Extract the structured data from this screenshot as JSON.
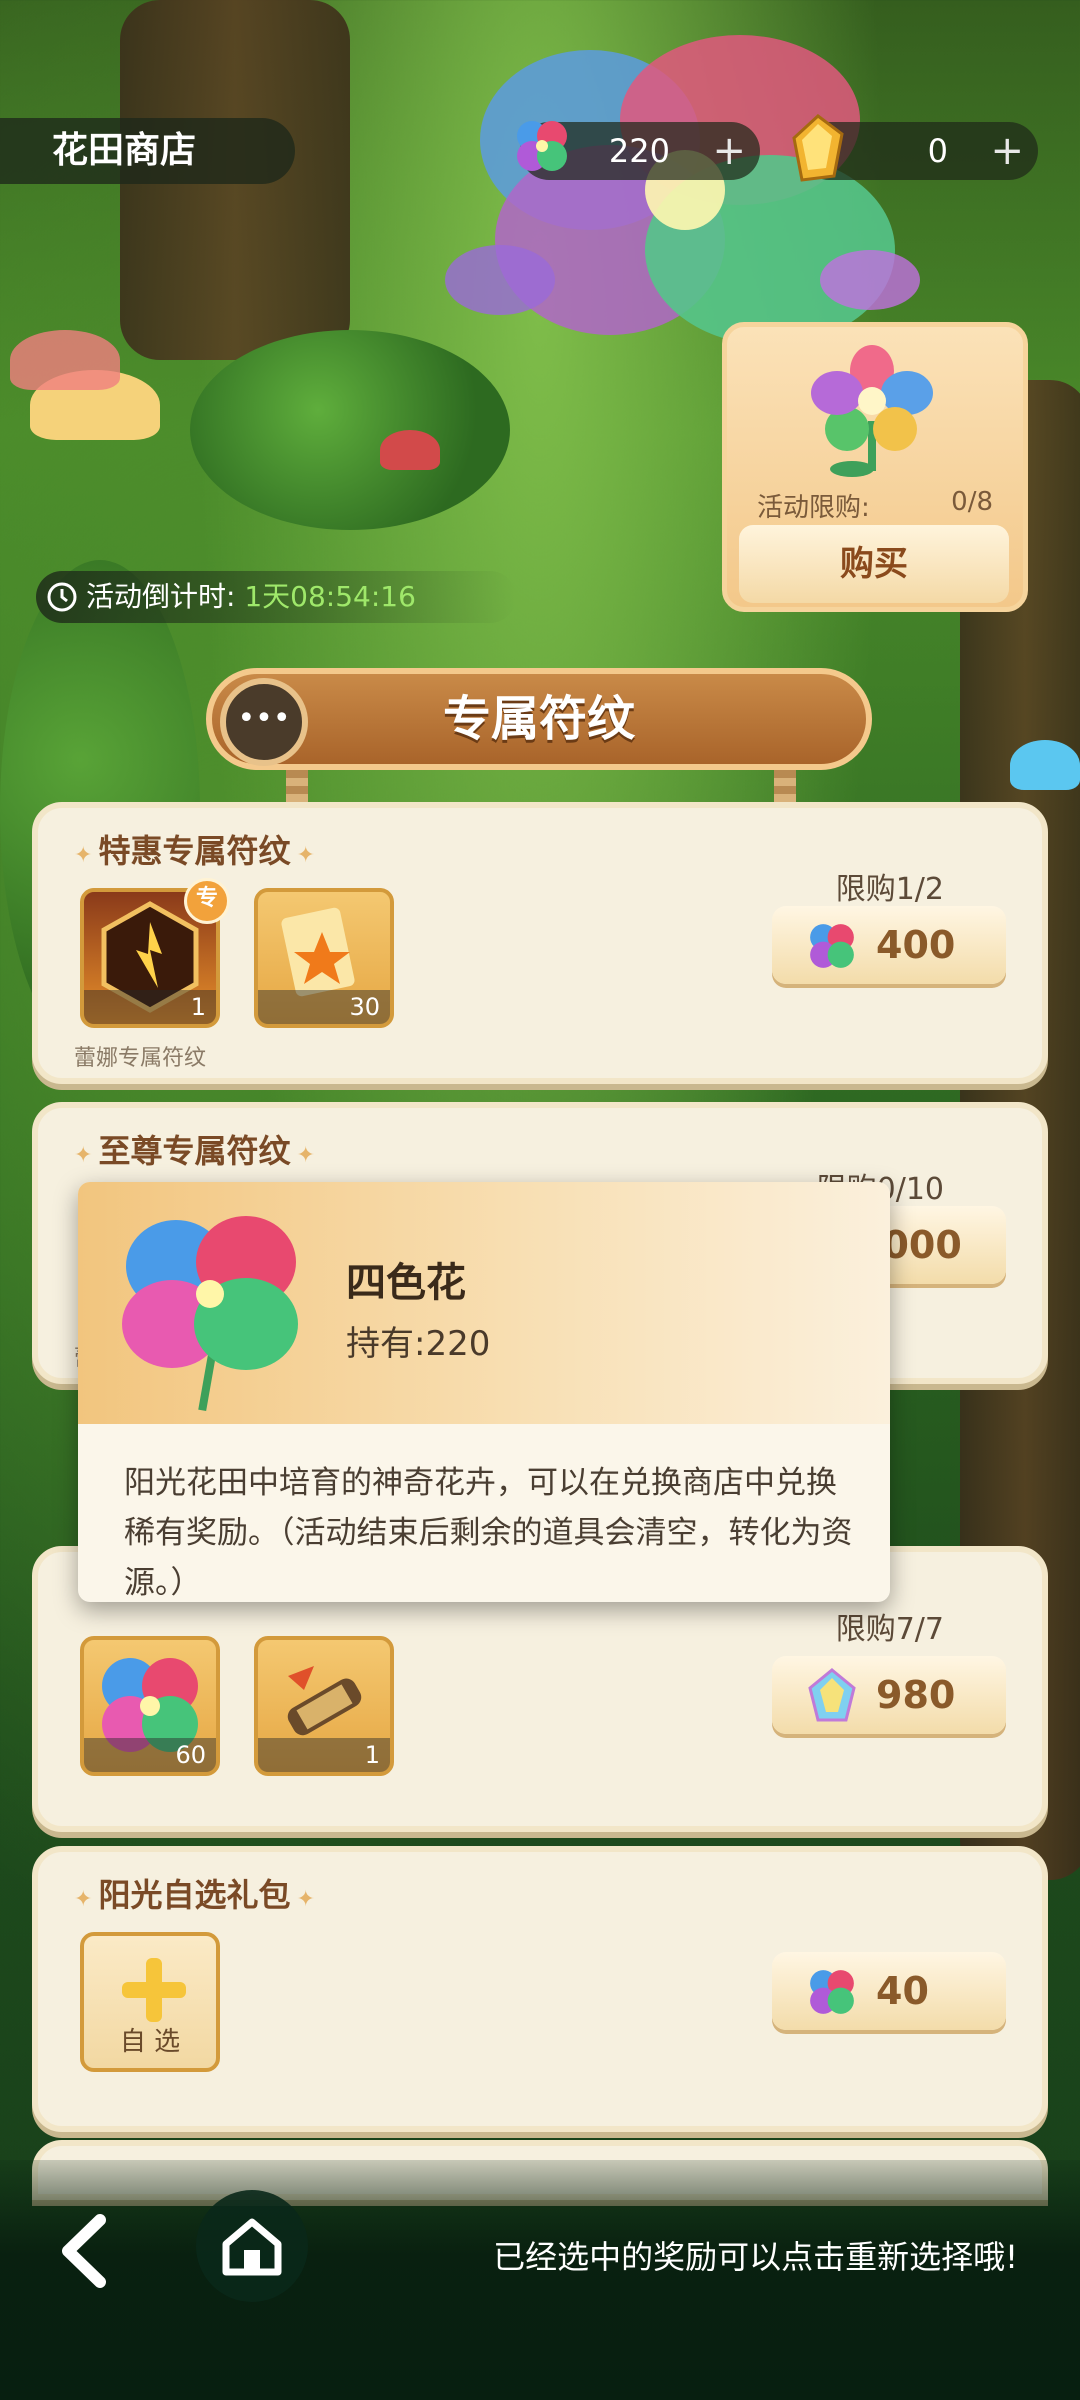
{
  "header": {
    "title": "花田商店",
    "currencies": [
      {
        "icon": "four-color-flower-icon",
        "value": "220",
        "plus": "+"
      },
      {
        "icon": "gold-crystal-icon",
        "value": "0",
        "plus": "+"
      }
    ]
  },
  "countdown": {
    "label": "活动倒计时:",
    "time": "1天08:54:16"
  },
  "limited_card": {
    "label": "活动限购:",
    "count": "0/8",
    "buy": "购买"
  },
  "section_banner": {
    "title": "专属符纹"
  },
  "cards": [
    {
      "title": "特惠专属符纹",
      "limit": "限购1/2",
      "price": "400",
      "price_icon": "four-color-flower-icon",
      "items": [
        {
          "icon": "rune-fire-icon",
          "qty": "1",
          "badge": "专"
        },
        {
          "icon": "rune-fragment-icon",
          "qty": "30"
        }
      ],
      "caption": "蕾娜专属符纹"
    },
    {
      "title": "至尊专属符纹",
      "limit": "限购0/10",
      "price": "4000",
      "caption": "蕾"
    },
    {
      "limit": "限购7/7",
      "price": "980",
      "price_icon": "crystal-gem-icon",
      "items": [
        {
          "icon": "four-color-flower-icon",
          "qty": "60"
        },
        {
          "icon": "scroll-icon",
          "qty": "1"
        }
      ]
    },
    {
      "title": "阳光自选礼包",
      "price": "40",
      "price_icon": "four-color-flower-icon",
      "select_label": "自 选"
    }
  ],
  "tooltip": {
    "name": "四色花",
    "owned": "持有:220",
    "description": "阳光花田中培育的神奇花卉，可以在兑换商店中兑换稀有奖励。（活动结束后剩余的道具会清空，转化为资源。）"
  },
  "footer": {
    "hint": "已经选中的奖励可以点击重新选择哦!"
  }
}
